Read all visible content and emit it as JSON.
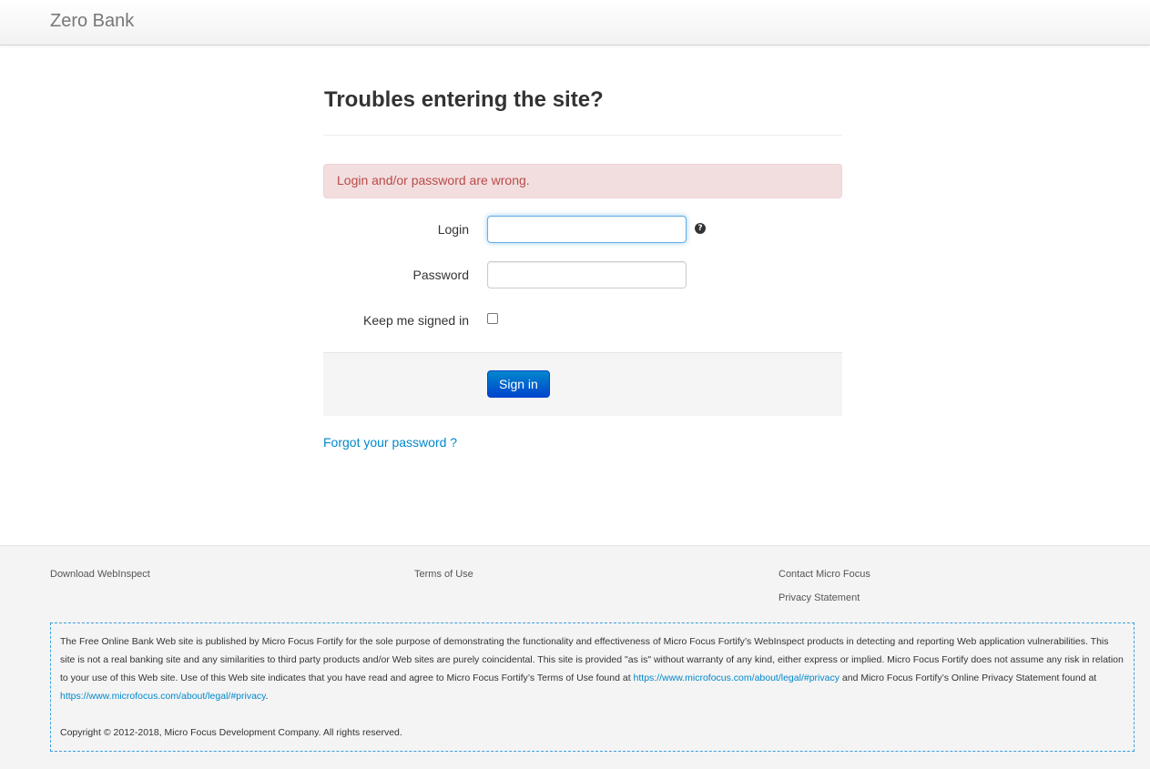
{
  "navbar": {
    "brand": "Zero Bank"
  },
  "main": {
    "title": "Troubles entering the site?",
    "alert": "Login and/or password are wrong.",
    "login_label": "Login",
    "password_label": "Password",
    "keep_signed_label": "Keep me signed in",
    "login_value": "",
    "password_value": "",
    "help_icon_glyph": "?",
    "signin_label": "Sign in",
    "forgot_link": "Forgot your password ?"
  },
  "footer": {
    "links": {
      "download": "Download WebInspect",
      "terms": "Terms of Use",
      "contact": "Contact Micro Focus",
      "privacy": "Privacy Statement"
    },
    "disclaimer": {
      "text_1": "The Free Online Bank Web site is published by Micro Focus Fortify for the sole purpose of demonstrating the functionality and effectiveness of Micro Focus Fortify’s WebInspect products in detecting and reporting Web application vulnerabilities. This site is not a real banking site and any similarities to third party products and/or Web sites are purely coincidental. This site is provided \"as is\" without warranty of any kind, either express or implied. Micro Focus Fortify does not assume any risk in relation to your use of this Web site. Use of this Web site indicates that you have read and agree to Micro Focus Fortify’s Terms of Use found at ",
      "link_1": "https://www.microfocus.com/about/legal/#privacy",
      "text_2": " and Micro Focus Fortify’s Online Privacy Statement found at ",
      "link_2": "https://www.microfocus.com/about/legal/#privacy",
      "text_3": ".",
      "copyright": "Copyright © 2012-2018, Micro Focus Development Company. All rights reserved."
    }
  },
  "colors": {
    "alert_bg": "#f2dede",
    "alert_text": "#b94a48",
    "link": "#0088cc",
    "primary_button": "#0044cc"
  }
}
